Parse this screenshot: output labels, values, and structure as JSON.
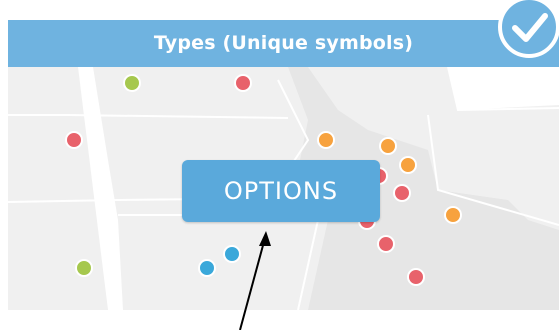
{
  "header": {
    "title": "Types (Unique symbols)",
    "bar_color": "#6fb3e0",
    "check_icon": "check-icon"
  },
  "options_button": {
    "label": "OPTIONS",
    "color": "#5aa9db"
  },
  "colors": {
    "red": "#e8626b",
    "orange": "#f7a23e",
    "green": "#a6c84e",
    "blue": "#3aa8da"
  },
  "annotation": {
    "arrow_icon": "arrow-icon"
  }
}
